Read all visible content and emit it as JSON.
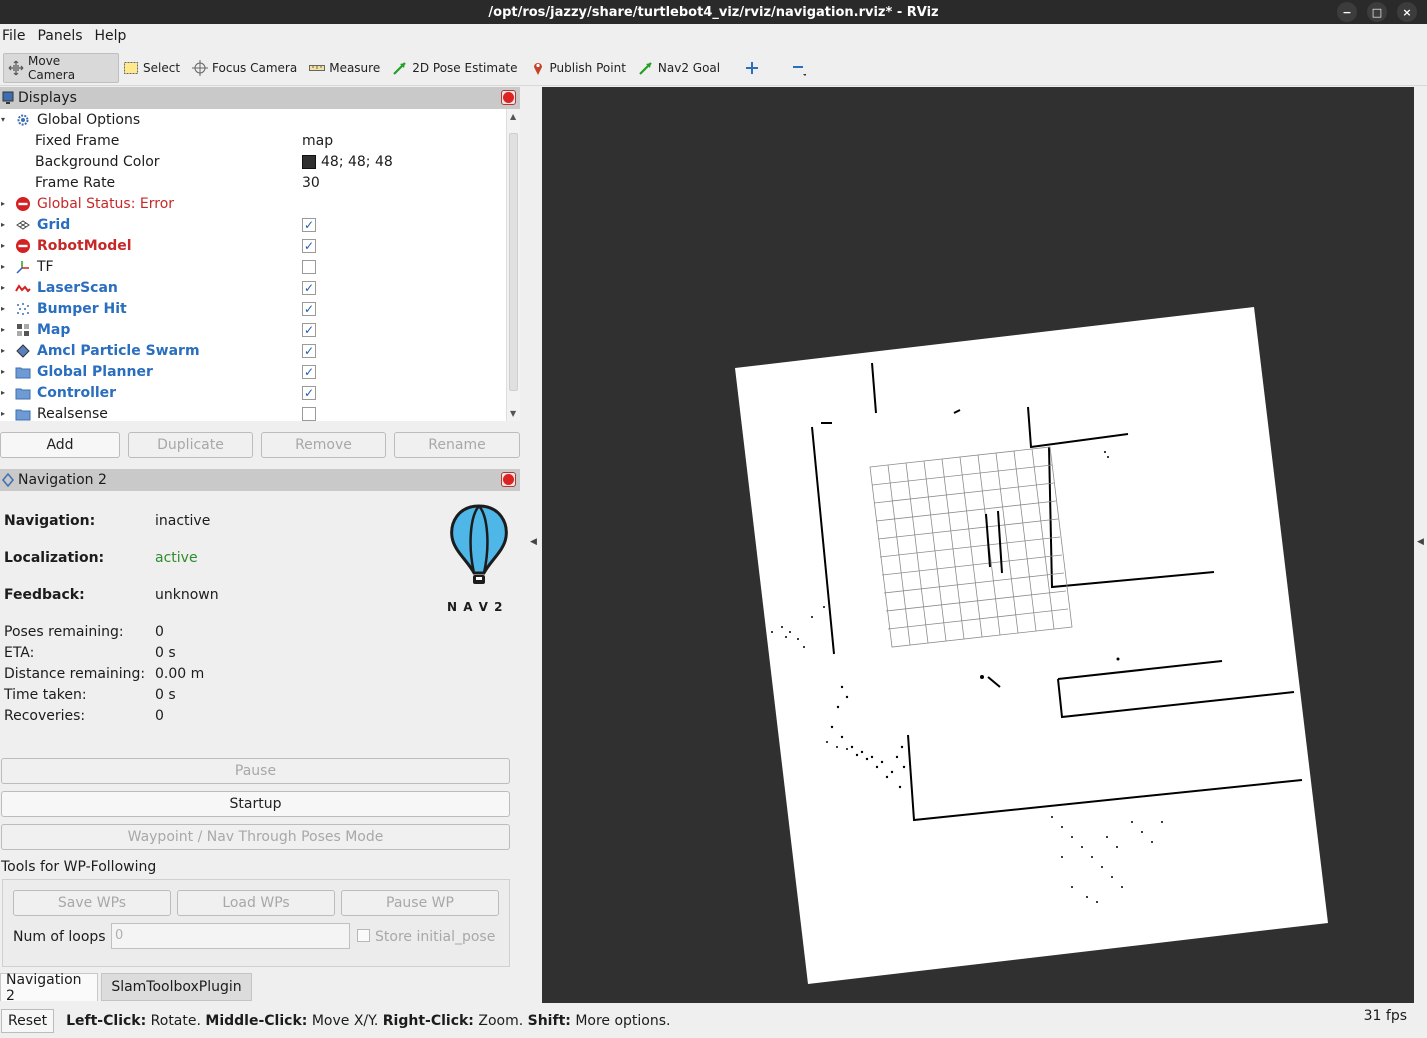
{
  "window": {
    "title": "/opt/ros/jazzy/share/turtlebot4_viz/rviz/navigation.rviz* - RViz",
    "controls": [
      "−",
      "□",
      "×"
    ]
  },
  "menu": [
    "File",
    "Panels",
    "Help"
  ],
  "toolbar": [
    {
      "label": "Move Camera",
      "icon": "move-camera-icon",
      "active": true
    },
    {
      "label": "Select",
      "icon": "select-icon"
    },
    {
      "label": "Focus Camera",
      "icon": "focus-camera-icon"
    },
    {
      "label": "Measure",
      "icon": "ruler-icon"
    },
    {
      "label": "2D Pose Estimate",
      "icon": "green-arrow-icon"
    },
    {
      "label": "Publish Point",
      "icon": "pin-icon"
    },
    {
      "label": "Nav2 Goal",
      "icon": "green-arrow-icon"
    },
    {
      "label": "",
      "icon": "plus-icon"
    },
    {
      "label": "",
      "icon": "minus-icon"
    }
  ],
  "displays": {
    "title": "Displays",
    "global_options": "Global Options",
    "fixed_frame_label": "Fixed Frame",
    "fixed_frame_value": "map",
    "bg_color_label": "Background Color",
    "bg_color_value": "48; 48; 48",
    "bg_color_swatch": "#303030",
    "frame_rate_label": "Frame Rate",
    "frame_rate_value": "30",
    "global_status": "Global Status: Error",
    "items": [
      {
        "label": "Grid",
        "style": "blue",
        "checked": true,
        "icon": "grid-icon"
      },
      {
        "label": "RobotModel",
        "style": "red",
        "checked": true,
        "icon": "error-icon"
      },
      {
        "label": "TF",
        "style": "plain",
        "checked": false,
        "icon": "tf-axes-icon"
      },
      {
        "label": "LaserScan",
        "style": "blue",
        "checked": true,
        "icon": "laser-scan-icon"
      },
      {
        "label": "Bumper Hit",
        "style": "blue",
        "checked": true,
        "icon": "point-cloud-icon"
      },
      {
        "label": "Map",
        "style": "blue",
        "checked": true,
        "icon": "map-icon"
      },
      {
        "label": "Amcl Particle Swarm",
        "style": "blue",
        "checked": true,
        "icon": "particle-swarm-icon"
      },
      {
        "label": "Global Planner",
        "style": "blue",
        "checked": true,
        "icon": "folder-icon"
      },
      {
        "label": "Controller",
        "style": "blue",
        "checked": true,
        "icon": "folder-icon"
      },
      {
        "label": "Realsense",
        "style": "plain",
        "checked": false,
        "icon": "folder-icon"
      }
    ],
    "buttons": {
      "add": "Add",
      "duplicate": "Duplicate",
      "remove": "Remove",
      "rename": "Rename"
    }
  },
  "nav2": {
    "title": "Navigation 2",
    "navigation_label": "Navigation:",
    "navigation_value": "inactive",
    "localization_label": "Localization:",
    "localization_value": "active",
    "feedback_label": "Feedback:",
    "feedback_value": "unknown",
    "poses_label": "Poses remaining:",
    "poses_value": "0",
    "eta_label": "ETA:",
    "eta_value": "0 s",
    "distance_label": "Distance remaining:",
    "distance_value": "0.00 m",
    "time_label": "Time taken:",
    "time_value": "0 s",
    "recoveries_label": "Recoveries:",
    "recoveries_value": "0",
    "logo_text": "N A V 2",
    "pause": "Pause",
    "startup": "Startup",
    "waypoint_mode": "Waypoint / Nav Through Poses Mode",
    "tools_title": "Tools for WP-Following",
    "save_wps": "Save WPs",
    "load_wps": "Load WPs",
    "pause_wp": "Pause WP",
    "num_loops_label": "Num of loops",
    "num_loops_value": "0",
    "store_initial_pose": "Store initial_pose"
  },
  "tabs": [
    "Navigation 2",
    "SlamToolboxPlugin"
  ],
  "status": {
    "reset": "Reset",
    "left_click": "Left-Click:",
    "left_click_desc": "Rotate.",
    "middle_click": "Middle-Click:",
    "middle_click_desc": "Move X/Y.",
    "right_click": "Right-Click:",
    "right_click_desc": "Zoom.",
    "shift": "Shift:",
    "shift_desc": "More options.",
    "fps": "31 fps"
  }
}
